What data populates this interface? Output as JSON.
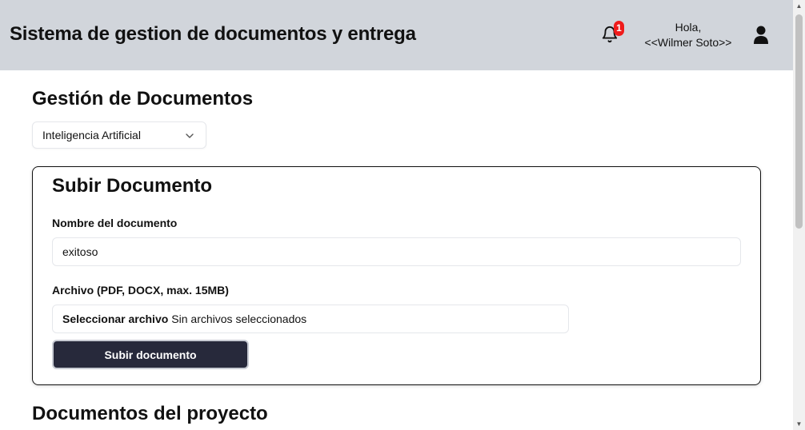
{
  "header": {
    "app_title": "Sistema de gestion de documentos y entrega",
    "notification_count": "1",
    "greeting_line1": "Hola,",
    "greeting_line2": "<<Wilmer Soto>>"
  },
  "main": {
    "heading": "Gestión de Documentos",
    "project_select": {
      "selected": "Inteligencia Artificial"
    },
    "upload_card": {
      "title": "Subir Documento",
      "name_label": "Nombre del documento",
      "name_value": "exitoso",
      "file_label": "Archivo (PDF, DOCX, max. 15MB)",
      "file_button": "Seleccionar archivo",
      "file_status": "Sin archivos seleccionados",
      "submit_label": "Subir documento"
    },
    "documents_heading": "Documentos del proyecto"
  },
  "colors": {
    "header_bg": "#d1d5db",
    "badge": "#ef1b1b",
    "primary_button": "#27293b"
  },
  "icons": {
    "notifications": "bell-icon",
    "user": "user-icon",
    "dropdown": "chevron-down-icon"
  }
}
